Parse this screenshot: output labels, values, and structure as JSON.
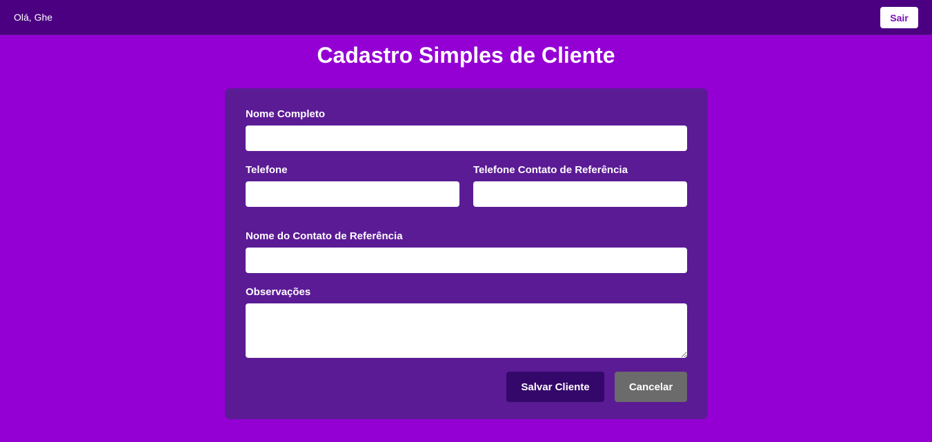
{
  "header": {
    "greeting": "Olá, Ghe",
    "logout_label": "Sair"
  },
  "page": {
    "title": "Cadastro Simples de Cliente"
  },
  "form": {
    "full_name": {
      "label": "Nome Completo",
      "value": ""
    },
    "phone": {
      "label": "Telefone",
      "value": ""
    },
    "reference_phone": {
      "label": "Telefone Contato de Referência",
      "value": ""
    },
    "reference_name": {
      "label": "Nome do Contato de Referência",
      "value": ""
    },
    "notes": {
      "label": "Observações",
      "value": ""
    },
    "save_label": "Salvar Cliente",
    "cancel_label": "Cancelar"
  },
  "colors": {
    "background": "#9400d3",
    "header": "#4b0082",
    "card": "#5b1b95",
    "save_button": "#34086a",
    "cancel_button": "#6b6b6b"
  }
}
